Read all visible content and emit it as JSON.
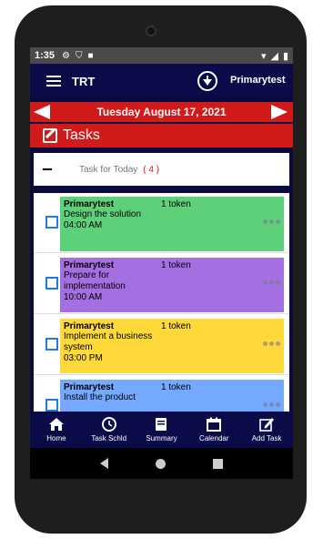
{
  "status": {
    "time": "1:35"
  },
  "appbar": {
    "title": "TRT",
    "username": "Primarytest"
  },
  "date": {
    "label": "Tuesday August 17, 2021"
  },
  "tasks": {
    "heading": "Tasks"
  },
  "today": {
    "label": "Task for Today",
    "count": "( 4 )"
  },
  "items": [
    {
      "user": "Primarytest",
      "tokens": "1 token",
      "desc": "Design the solution",
      "time": "04:00 AM",
      "color": "#5fd07a"
    },
    {
      "user": "Primarytest",
      "tokens": "1 token",
      "desc": "Prepare for implementation",
      "time": "10:00 AM",
      "color": "#a46fe0"
    },
    {
      "user": "Primarytest",
      "tokens": "1 token",
      "desc": "Implement a business system",
      "time": "03:00 PM",
      "color": "#ffd83a"
    },
    {
      "user": "Primarytest",
      "tokens": "1 token",
      "desc": "Install the product",
      "time": "",
      "color": "#74a9ff"
    }
  ],
  "nav": [
    {
      "label": "Home",
      "icon": "home-icon"
    },
    {
      "label": "Task Schld",
      "icon": "clock-icon"
    },
    {
      "label": "Summary",
      "icon": "book-icon"
    },
    {
      "label": "Calendar",
      "icon": "calendar-icon"
    },
    {
      "label": "Add Task",
      "icon": "edit-icon"
    }
  ],
  "colors": {
    "appbar": "#0b0b4a",
    "accent_red": "#d11a1a",
    "checkbox": "#1e7be6"
  }
}
